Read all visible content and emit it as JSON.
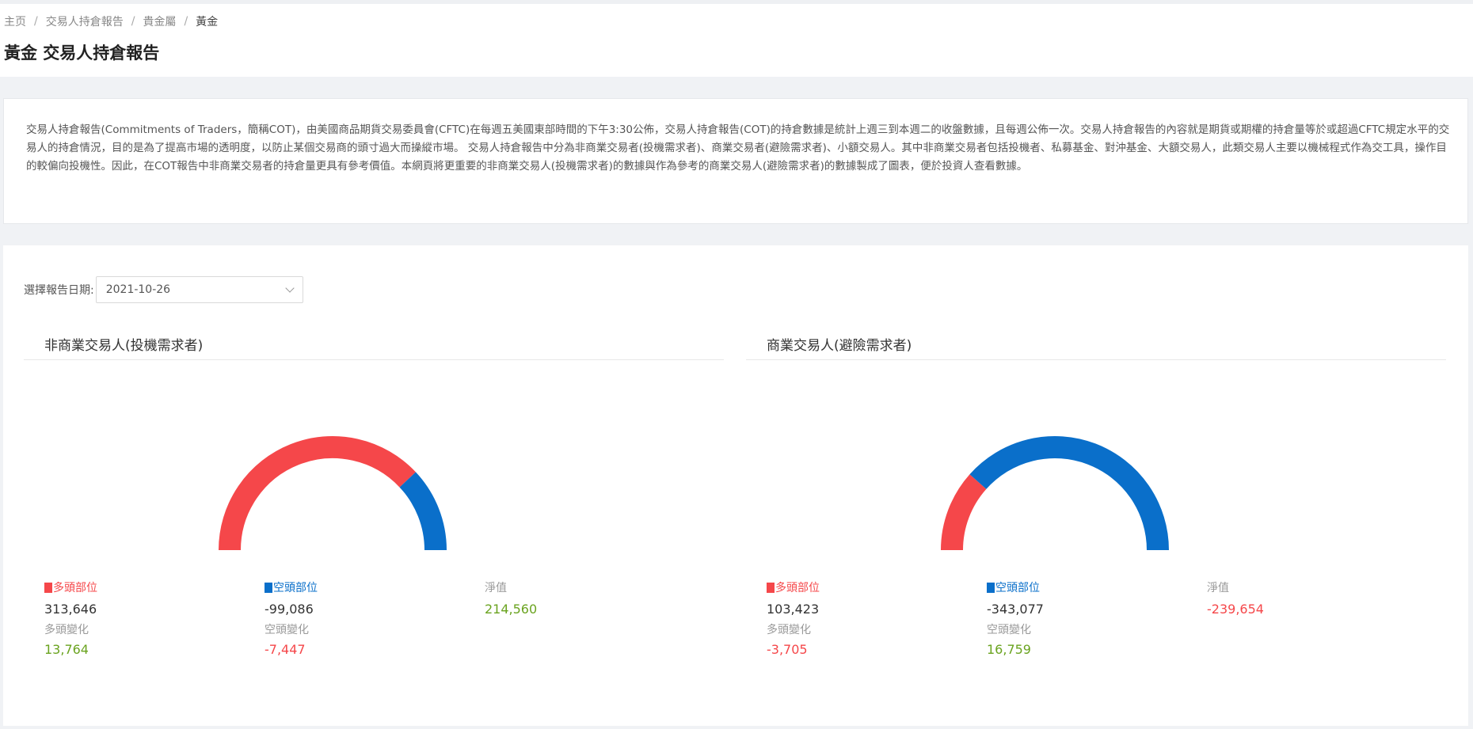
{
  "breadcrumb": [
    "主页",
    "交易人持倉報告",
    "貴金屬",
    "黃金"
  ],
  "page_title": "黃金 交易人持倉報告",
  "intro": "交易人持倉報告(Commitments of Traders，簡稱COT)，由美國商品期貨交易委員會(CFTC)在每週五美國東部時間的下午3:30公佈，交易人持倉報告(COT)的持倉數據是統計上週三到本週二的收盤數據，且每週公佈一次。交易人持倉報告的內容就是期貨或期權的持倉量等於或超過CFTC規定水平的交易人的持倉情況，目的是為了提高市場的透明度，以防止某個交易商的頭寸過大而操縱市場。 交易人持倉報告中分為非商業交易者(投機需求者)、商業交易者(避險需求者)、小額交易人。其中非商業交易者包括投機者、私募基金、對沖基金、大額交易人，此類交易人主要以機械程式作為交工具，操作目的較偏向投機性。因此，在COT報告中非商業交易者的持倉量更具有參考價值。本網頁將更重要的非商業交易人(投機需求者)的數據與作為參考的商業交易人(避險需求者)的數據製成了圖表，便於投資人查看數據。",
  "date_select": {
    "label": "選擇報告日期:",
    "value": "2021-10-26"
  },
  "colors": {
    "long": "#f5474a",
    "short": "#0a6fca",
    "positive": "#6aa31f",
    "negative": "#f5474a"
  },
  "panels": [
    {
      "title": "非商業交易人(投機需求者)",
      "long_label": "多頭部位",
      "long_value": "313,646",
      "long_change_label": "多頭變化",
      "long_change": "13,764",
      "short_label": "空頭部位",
      "short_value": "-99,086",
      "short_change_label": "空頭變化",
      "short_change": "-7,447",
      "net_label": "淨值",
      "net_value": "214,560",
      "chart_data": {
        "type": "gauge",
        "long": 313646,
        "short": 99086
      }
    },
    {
      "title": "商業交易人(避險需求者)",
      "long_label": "多頭部位",
      "long_value": "103,423",
      "long_change_label": "多頭變化",
      "long_change": "-3,705",
      "short_label": "空頭部位",
      "short_value": "-343,077",
      "short_change_label": "空頭變化",
      "short_change": "16,759",
      "net_label": "淨值",
      "net_value": "-239,654",
      "chart_data": {
        "type": "gauge",
        "long": 103423,
        "short": 343077
      }
    }
  ]
}
